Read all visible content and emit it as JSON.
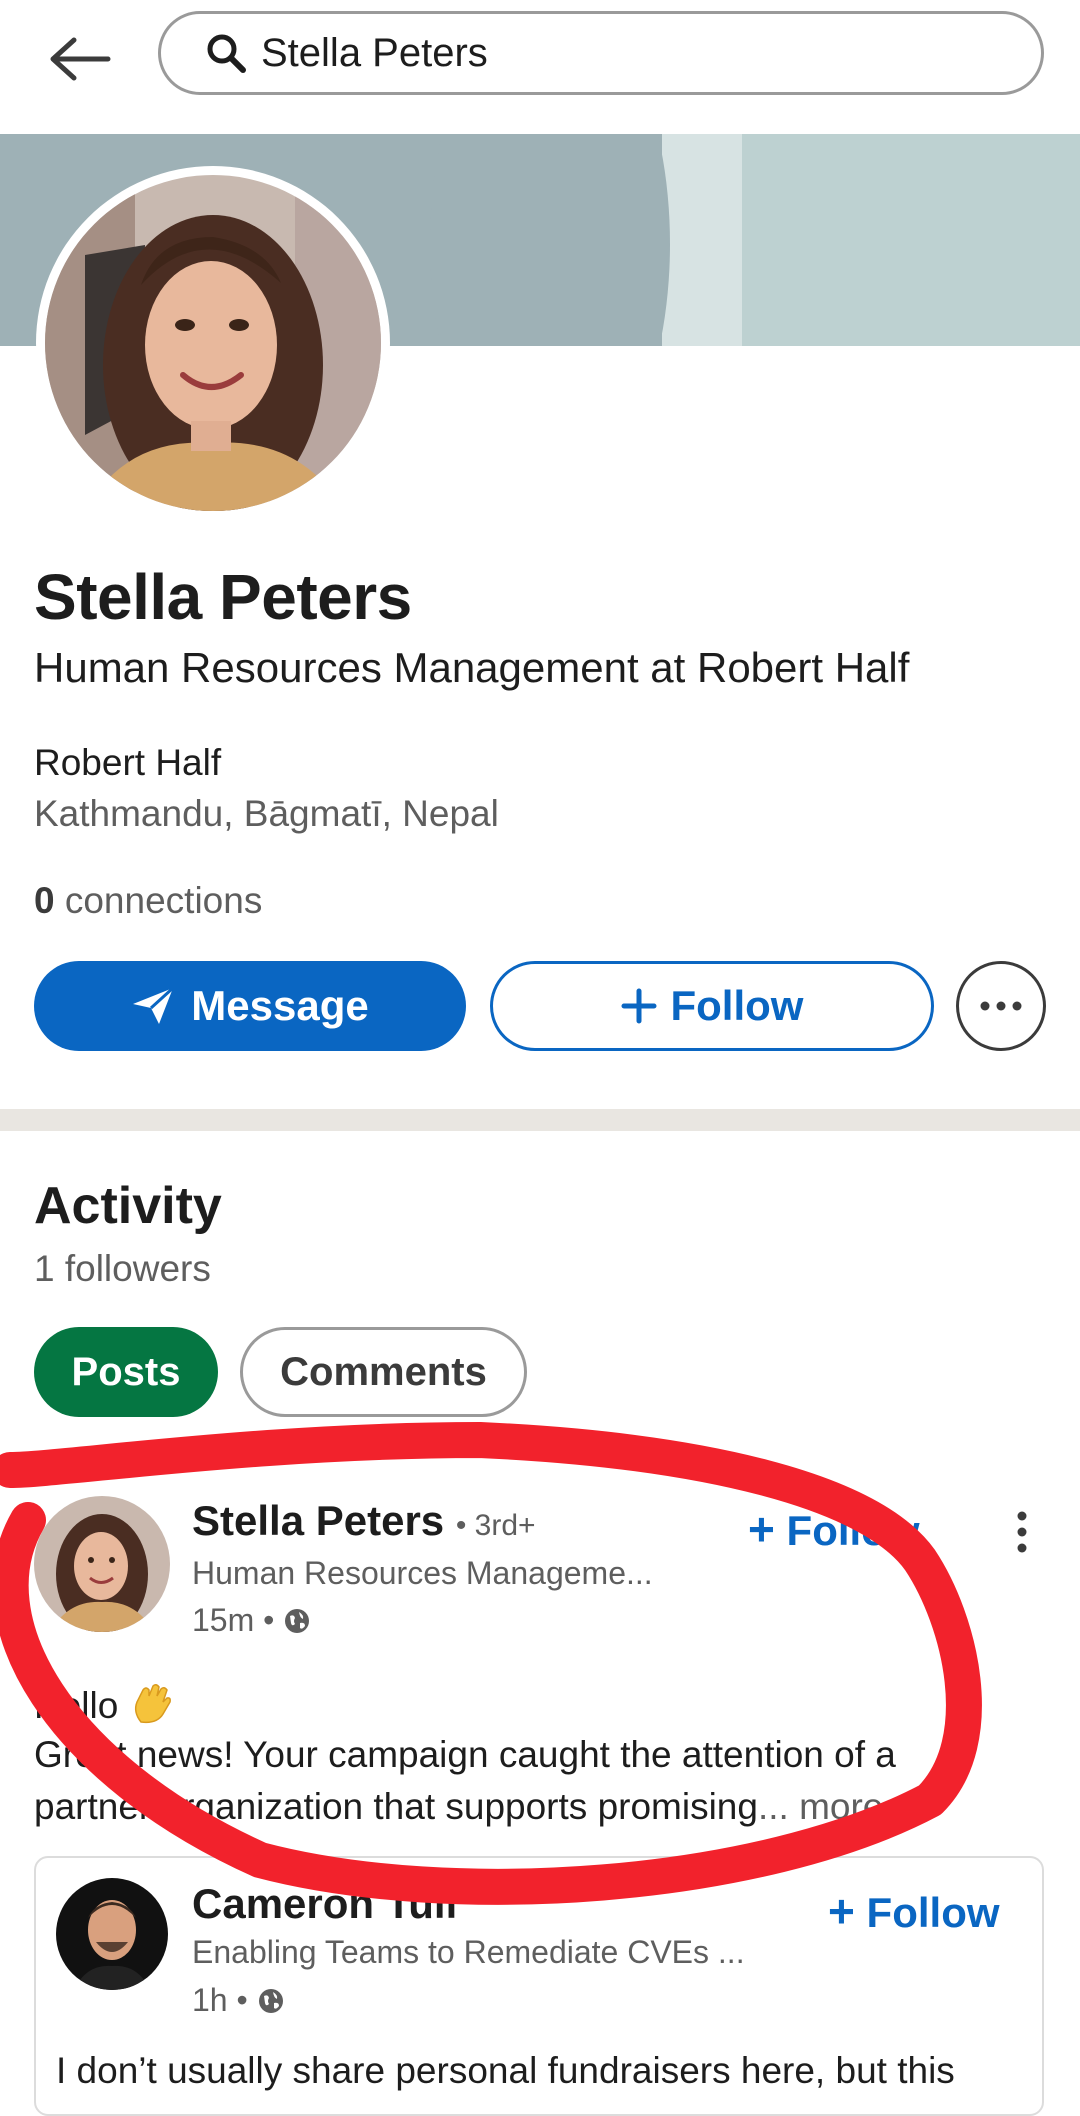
{
  "search": {
    "query": "Stella Peters"
  },
  "profile": {
    "name": "Stella Peters",
    "headline": "Human Resources Management at Robert Half",
    "company": "Robert Half",
    "location": "Kathmandu, Bāgmatī, Nepal",
    "connections_count": "0",
    "connections_label": "connections"
  },
  "actions": {
    "message_label": "Message",
    "follow_label": "Follow"
  },
  "activity": {
    "title": "Activity",
    "followers": "1 followers",
    "tabs": [
      {
        "label": "Posts",
        "selected": true
      },
      {
        "label": "Comments",
        "selected": false
      }
    ]
  },
  "post": {
    "author": "Stella Peters",
    "degree": "• 3rd+",
    "headline": "Human Resources Manageme...",
    "time": "15m •",
    "follow_label": "Follow",
    "lines": [
      "Hello",
      "Great news! Your campaign caught the attention of a",
      "partner organization that supports promising"
    ],
    "more_label": "... more"
  },
  "shared": {
    "author": "Cameron Tull",
    "headline": "Enabling Teams to Remediate CVEs ...",
    "time": "1h •",
    "follow_label": "Follow",
    "text": "I don’t usually share personal fundraisers here, but this"
  },
  "colors": {
    "brand_blue": "#0a66c2",
    "posts_green": "#057642",
    "annotation_red": "#f2222c"
  },
  "icons": [
    "back-arrow-icon",
    "search-icon",
    "send-icon",
    "plus-icon",
    "more-horizontal-icon",
    "more-vertical-icon",
    "globe-icon",
    "wave-emoji-icon"
  ]
}
